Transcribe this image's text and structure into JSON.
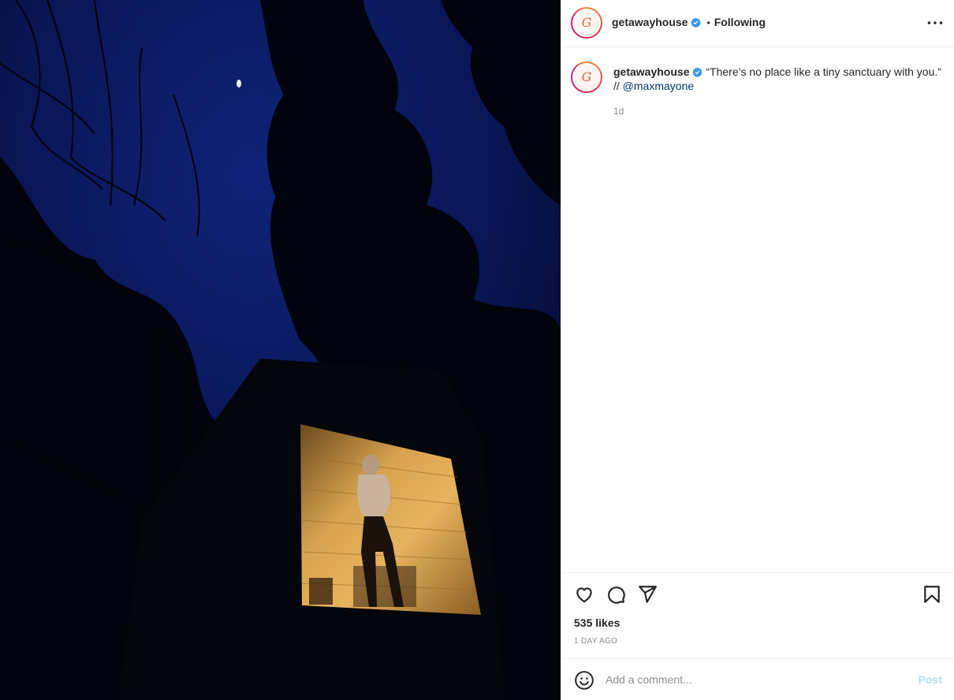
{
  "post": {
    "username": "getawayhouse",
    "avatar_letter": "G",
    "follow_status": "Following",
    "separator": "•"
  },
  "caption": {
    "username": "getawayhouse",
    "text": "“There’s no place like a tiny sanctuary with you.” //",
    "mention": "@maxmayone",
    "age": "1d"
  },
  "engagement": {
    "likes": "535 likes",
    "timestamp": "1 DAY AGO"
  },
  "comment_box": {
    "placeholder": "Add a comment...",
    "post_label": "Post"
  },
  "icons": {
    "verified": "verified-badge-icon",
    "more": "more-options-icon",
    "like": "heart-icon",
    "comment": "comment-icon",
    "share": "share-icon",
    "save": "bookmark-icon",
    "emoji": "emoji-icon"
  },
  "colors": {
    "verified_blue": "#3897f0",
    "mention": "#00376b",
    "muted": "#8e8e8e",
    "post_disabled": "#b2dffc",
    "sky": "#0c1a5a"
  }
}
